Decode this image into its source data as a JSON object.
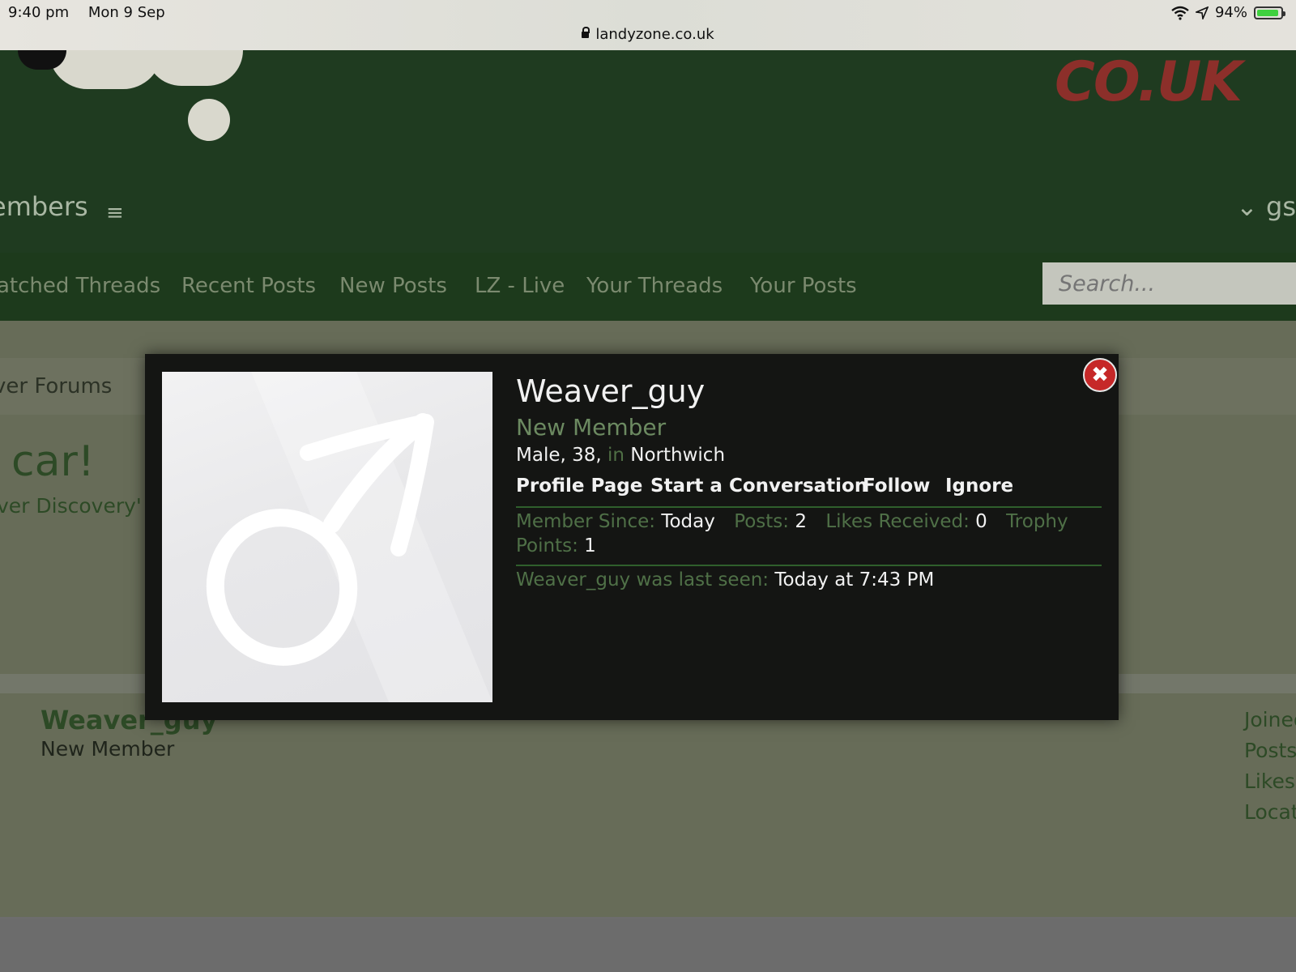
{
  "status_bar": {
    "time": "9:40 pm",
    "date": "Mon 9 Sep",
    "battery": "94%",
    "url": "landyzone.co.uk"
  },
  "site": {
    "logo_text": "CO.UK",
    "nav_members": "embers",
    "nav_right": "gs",
    "subnav": [
      "atched Threads",
      "Recent Posts",
      "New Posts",
      "LZ - Live",
      "Your Threads",
      "Your Posts"
    ],
    "search_placeholder": "Search...",
    "breadcrumb": "ver Forums",
    "heading_fragment": "car!",
    "subheading_fragment": "ver Discovery' s",
    "member_name": "Weaver_guy",
    "member_title": "New Member",
    "right_labels": [
      "Joined",
      "Posts",
      "Likes",
      "Locat"
    ]
  },
  "modal": {
    "name": "Weaver_guy",
    "title": "New Member",
    "gender_age": "Male, 38,",
    "in_word": "in",
    "location": "Northwich",
    "links": {
      "profile": "Profile Page",
      "conversation": "Start a Conversation",
      "follow": "Follow",
      "ignore": "Ignore"
    },
    "stats": {
      "member_since_label": "Member Since:",
      "member_since_value": "Today",
      "posts_label": "Posts:",
      "posts_value": "2",
      "likes_label": "Likes Received:",
      "likes_value": "0",
      "trophy_label": "Trophy Points:",
      "trophy_value": "1"
    },
    "last_seen_label": "Weaver_guy was last seen:",
    "last_seen_value": "Today at 7:43 PM",
    "close_icon": "close-icon",
    "avatar_icon": "male-symbol-icon"
  },
  "colors": {
    "header_green": "#1f3b20",
    "modal_bg": "#141513",
    "label_green": "#4f7047",
    "close_red": "#c62828"
  }
}
